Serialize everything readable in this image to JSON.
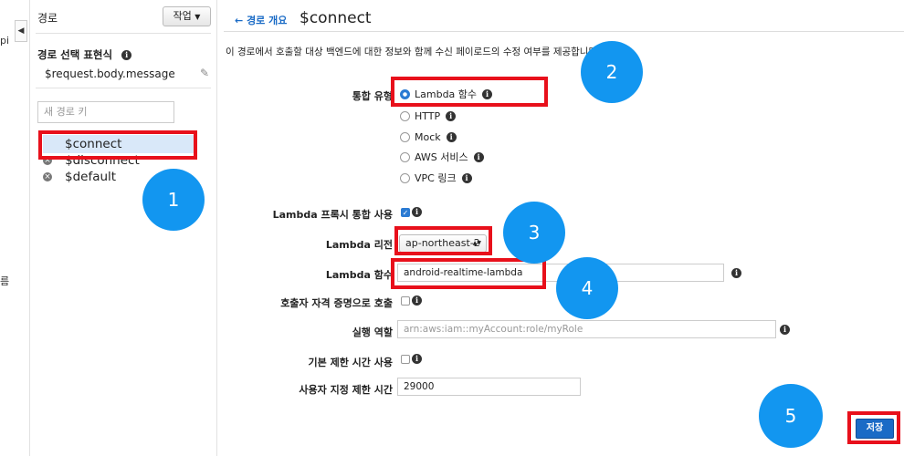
{
  "left_strip": {
    "fragment_top": "pi",
    "fragment_mid": "름"
  },
  "sidebar": {
    "title": "경로",
    "action_button": "작업",
    "route_expression_label": "경로 선택 표현식",
    "route_expression_value": "$request.body.message",
    "new_route_placeholder": "새 경로 키",
    "routes": [
      {
        "label": "$connect",
        "selected": true
      },
      {
        "label": "$disconnect",
        "selected": false
      },
      {
        "label": "$default",
        "selected": false
      }
    ]
  },
  "main": {
    "back_link": "경로 개요",
    "page_title": "$connect",
    "description": "이 경로에서 호출할 대상 백엔드에 대한 정보와 함께 수신 페이로드의 수정 여부를 제공합니다.",
    "integration_type_label": "통합 유형",
    "integration_types": [
      {
        "label": "Lambda 함수",
        "checked": true
      },
      {
        "label": "HTTP",
        "checked": false
      },
      {
        "label": "Mock",
        "checked": false
      },
      {
        "label": "AWS 서비스",
        "checked": false
      },
      {
        "label": "VPC 링크",
        "checked": false
      }
    ],
    "lambda_proxy_label": "Lambda 프록시 통합 사용",
    "lambda_proxy_checked": true,
    "lambda_region_label": "Lambda 리전",
    "lambda_region_value": "ap-northeast-2",
    "lambda_function_label": "Lambda 함수",
    "lambda_function_value": "android-realtime-lambda",
    "caller_credentials_label": "호출자 자격 증명으로 호출",
    "caller_credentials_checked": false,
    "execution_role_label": "실행 역할",
    "execution_role_placeholder": "arn:aws:iam::myAccount:role/myRole",
    "default_timeout_label": "기본 제한 시간 사용",
    "default_timeout_checked": false,
    "custom_timeout_label": "사용자 지정 제한 시간",
    "custom_timeout_value": "29000",
    "save_button": "저장"
  },
  "annotations": {
    "box_color": "#e8101b",
    "badge_color": "#1296f0",
    "badges": [
      "1",
      "2",
      "3",
      "4",
      "5"
    ]
  }
}
